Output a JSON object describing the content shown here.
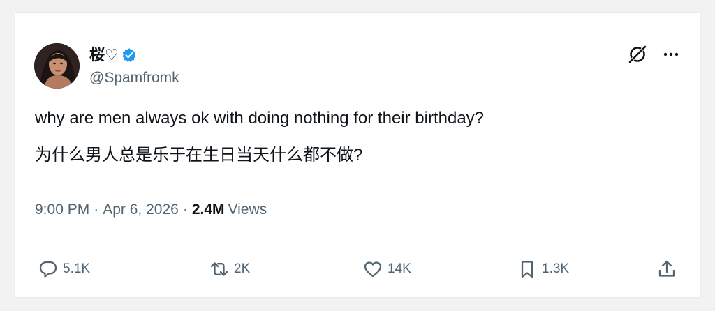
{
  "tweet": {
    "display_name": "桜♡",
    "handle": "@Spamfromk",
    "text_en": "why are men always ok with doing nothing for their birthday?",
    "text_cn": "为什么男人总是乐于在生日当天什么都不做?",
    "time": "9:00 PM",
    "date": "Apr 6, 2026",
    "views_count": "2.4M",
    "views_label": "Views",
    "verified": true
  },
  "actions": {
    "replies": "5.1K",
    "reposts": "2K",
    "likes": "14K",
    "bookmarks": "1.3K"
  },
  "icons": {
    "top": [
      "grok-icon",
      "more-icon"
    ],
    "actions": [
      "reply-icon",
      "repost-icon",
      "like-icon",
      "bookmark-icon",
      "share-icon"
    ]
  },
  "colors": {
    "verified_blue": "#1d9bf0",
    "secondary_text": "#536471",
    "primary_text": "#0f1419"
  }
}
